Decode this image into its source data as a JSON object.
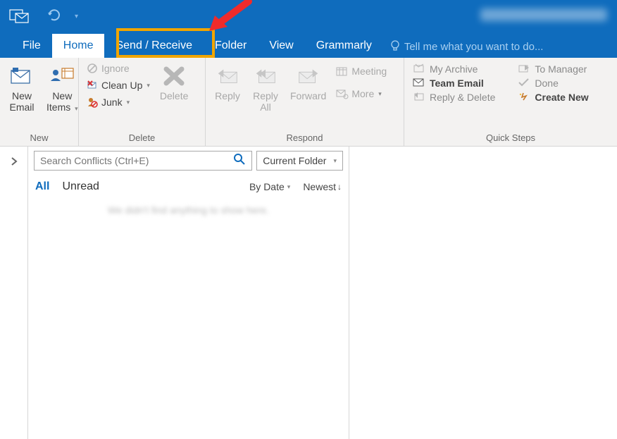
{
  "tabs": {
    "file": "File",
    "home": "Home",
    "send_receive": "Send / Receive",
    "folder": "Folder",
    "view": "View",
    "grammarly": "Grammarly"
  },
  "tellme": "Tell me what you want to do...",
  "ribbon": {
    "new": {
      "email": "New\nEmail",
      "items": "New\nItems",
      "label": "New"
    },
    "delete": {
      "ignore": "Ignore",
      "cleanup": "Clean Up",
      "junk": "Junk",
      "delete": "Delete",
      "label": "Delete"
    },
    "respond": {
      "reply": "Reply",
      "reply_all": "Reply\nAll",
      "forward": "Forward",
      "meeting": "Meeting",
      "more": "More",
      "label": "Respond"
    },
    "quicksteps": {
      "my_archive": "My Archive",
      "team_email": "Team Email",
      "reply_delete": "Reply & Delete",
      "to_manager": "To Manager",
      "done": "Done",
      "create_new": "Create New",
      "label": "Quick Steps"
    }
  },
  "search": {
    "placeholder": "Search Conflicts (Ctrl+E)",
    "scope": "Current Folder"
  },
  "filters": {
    "all": "All",
    "unread": "Unread",
    "by_date": "By Date",
    "newest": "Newest"
  },
  "empty": "We didn't find anything to show here."
}
